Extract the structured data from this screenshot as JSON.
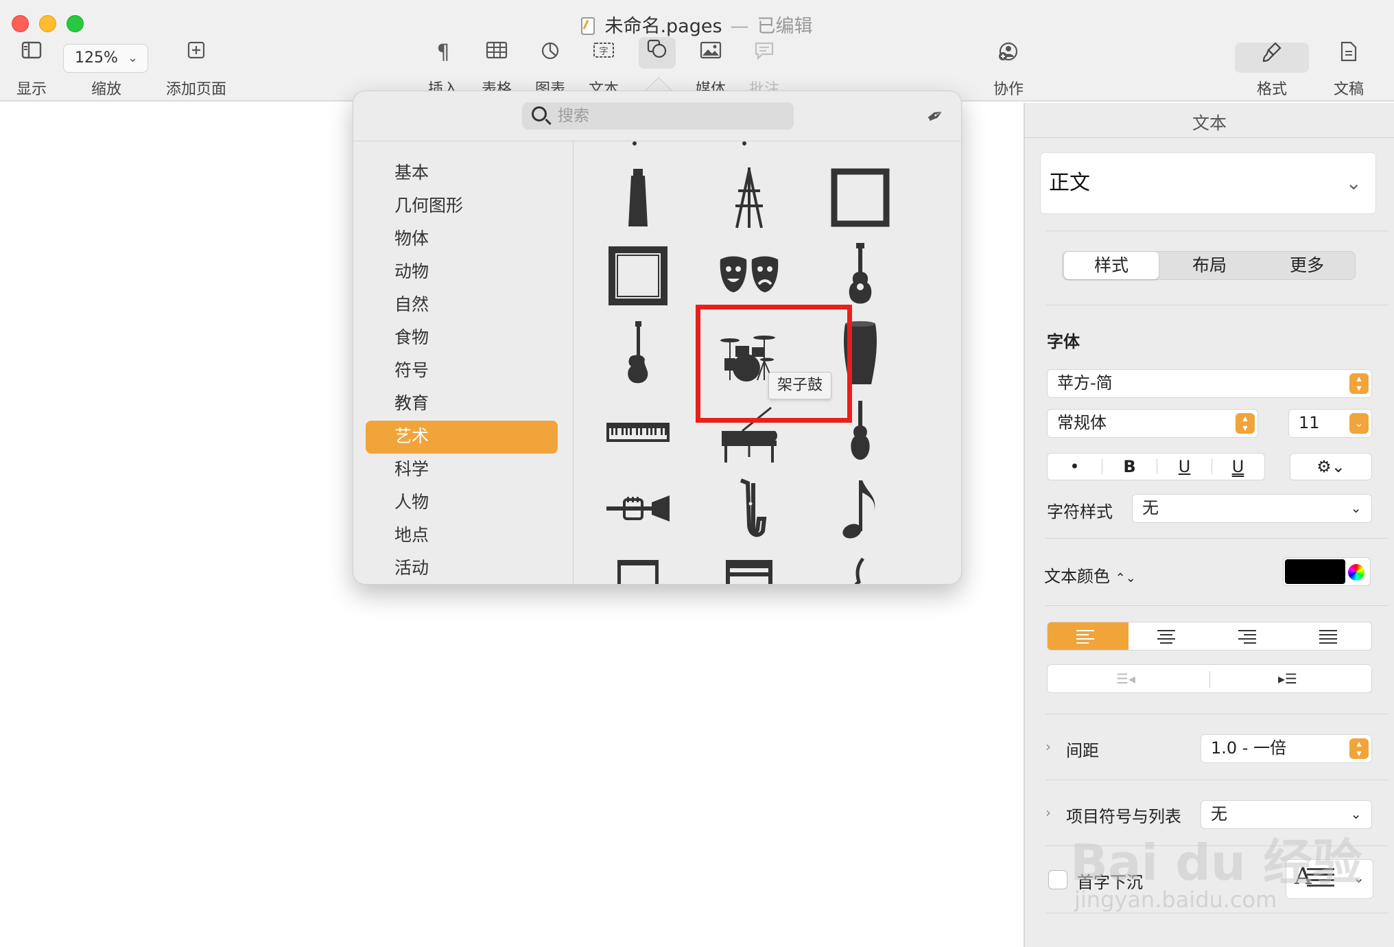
{
  "window": {
    "doc_name": "未命名.pages",
    "separator": "—",
    "edited_label": "已编辑"
  },
  "toolbar": {
    "view_label": "显示",
    "zoom_value": "125%",
    "zoom_label": "缩放",
    "add_page_label": "添加页面",
    "insert_label": "插入",
    "table_label": "表格",
    "chart_label": "图表",
    "text_label": "文本",
    "shape_label": "形状",
    "media_label": "媒体",
    "comment_label": "批注",
    "collaborate_label": "协作",
    "format_label": "格式",
    "document_label": "文稿"
  },
  "shape_library": {
    "search_placeholder": "搜索",
    "categories": [
      "基本",
      "几何图形",
      "物体",
      "动物",
      "自然",
      "食物",
      "符号",
      "教育",
      "艺术",
      "科学",
      "人物",
      "地点",
      "活动"
    ],
    "selected_category": "艺术",
    "shapes": [
      "paint-tube",
      "easel",
      "square-frame",
      "ornate-frame",
      "theater-masks",
      "acoustic-guitar",
      "electric-guitar",
      "drum-kit",
      "conga-drum",
      "keyboard",
      "grand-piano",
      "violin",
      "trumpet",
      "saxophone",
      "music-note",
      "beamed-notes",
      "bench",
      "treble-clef"
    ],
    "tooltip": "架子鼓",
    "highlight_color": "#e8201c"
  },
  "inspector": {
    "title": "文本",
    "paragraph_style": "正文",
    "tabs": [
      "样式",
      "布局",
      "更多"
    ],
    "active_tab": "样式",
    "font_section_label": "字体",
    "font_family": "苹方-简",
    "font_weight": "常规体",
    "font_size": "11",
    "format_buttons": [
      "•",
      "B",
      "U",
      "U"
    ],
    "char_style_label": "字符样式",
    "char_style_value": "无",
    "text_color_label": "文本颜色",
    "text_color": "#000000",
    "spacing_label": "间距",
    "spacing_value": "1.0 - 一倍",
    "bullets_label": "项目符号与列表",
    "bullets_value": "无",
    "dropcap_label": "首字下沉",
    "dropcap_glyph": "A",
    "accent_color": "#f0a43a"
  },
  "watermark": {
    "line1": "Bai du 经验",
    "line2": "jingyan.baidu.com"
  }
}
